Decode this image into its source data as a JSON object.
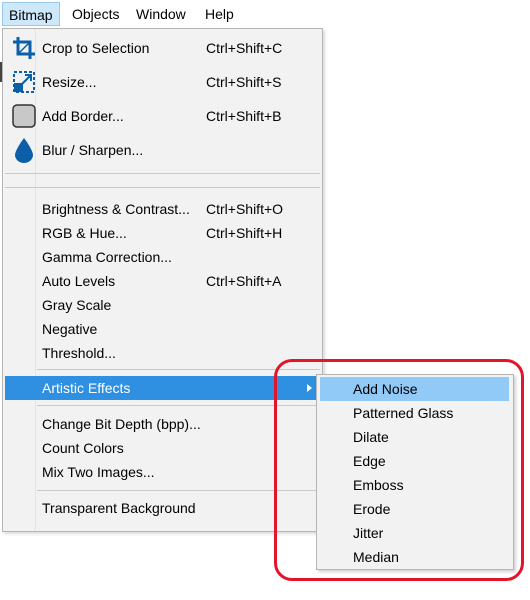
{
  "menubar": {
    "items": [
      {
        "label": "Bitmap"
      },
      {
        "label": "Objects"
      },
      {
        "label": "Window"
      },
      {
        "label": "Help"
      }
    ]
  },
  "bitmap_menu": {
    "tool_items": [
      {
        "label": "Crop to Selection",
        "shortcut": "Ctrl+Shift+C",
        "icon": "crop-icon"
      },
      {
        "label": "Resize...",
        "shortcut": "Ctrl+Shift+S",
        "icon": "resize-icon"
      },
      {
        "label": "Add Border...",
        "shortcut": "Ctrl+Shift+B",
        "icon": "border-icon"
      },
      {
        "label": "Blur / Sharpen...",
        "shortcut": "",
        "icon": "droplet-icon"
      }
    ],
    "adjust_items": [
      {
        "label": "Brightness & Contrast...",
        "shortcut": "Ctrl+Shift+O"
      },
      {
        "label": "RGB & Hue...",
        "shortcut": "Ctrl+Shift+H"
      },
      {
        "label": "Gamma Correction...",
        "shortcut": ""
      },
      {
        "label": "Auto Levels",
        "shortcut": "Ctrl+Shift+A"
      },
      {
        "label": "Gray Scale",
        "shortcut": ""
      },
      {
        "label": "Negative",
        "shortcut": ""
      },
      {
        "label": "Threshold...",
        "shortcut": ""
      }
    ],
    "artistic": {
      "label": "Artistic Effects"
    },
    "other_items": [
      {
        "label": "Change Bit Depth (bpp)..."
      },
      {
        "label": "Count Colors"
      },
      {
        "label": "Mix Two Images..."
      }
    ],
    "transparent": {
      "label": "Transparent Background"
    }
  },
  "artistic_submenu": {
    "items": [
      {
        "label": "Add Noise"
      },
      {
        "label": "Patterned Glass"
      },
      {
        "label": "Dilate"
      },
      {
        "label": "Edge"
      },
      {
        "label": "Emboss"
      },
      {
        "label": "Erode"
      },
      {
        "label": "Jitter"
      },
      {
        "label": "Median"
      }
    ]
  },
  "colors": {
    "highlight": "#2f8fe0",
    "submenu_highlight": "#91c9f7",
    "annotation": "#e3152b",
    "icon_blue": "#0a5fa8"
  }
}
